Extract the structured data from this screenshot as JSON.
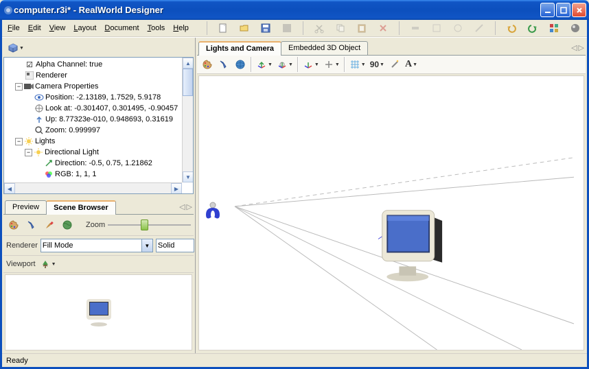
{
  "title": "computer.r3i* - RealWorld Designer",
  "menu": {
    "file": "File",
    "edit": "Edit",
    "view": "View",
    "layout": "Layout",
    "document": "Document",
    "tools": "Tools",
    "help": "Help"
  },
  "tree": {
    "alpha": "Alpha Channel: true",
    "renderer": "Renderer",
    "camera": "Camera Properties",
    "position": "Position: -2.13189, 1.7529, 5.9178",
    "lookat": "Look at: -0.301407, 0.301495, -0.90457",
    "up": "Up: 8.77323e-010, 0.948693, 0.31619",
    "zoom": "Zoom: 0.999997",
    "lights": "Lights",
    "dirlight": "Directional Light",
    "direction": "Direction: -0.5, 0.75, 1.21862",
    "rgb": "RGB: 1, 1, 1"
  },
  "leftTabs": {
    "preview": "Preview",
    "scene": "Scene Browser"
  },
  "rightTabs": {
    "lights": "Lights and Camera",
    "embedded": "Embedded 3D Object"
  },
  "preview": {
    "zoomLabel": "Zoom",
    "rendererLabel": "Renderer",
    "fillmode": "Fill Mode",
    "solid": "Solid",
    "viewportLabel": "Viewport"
  },
  "status": "Ready"
}
